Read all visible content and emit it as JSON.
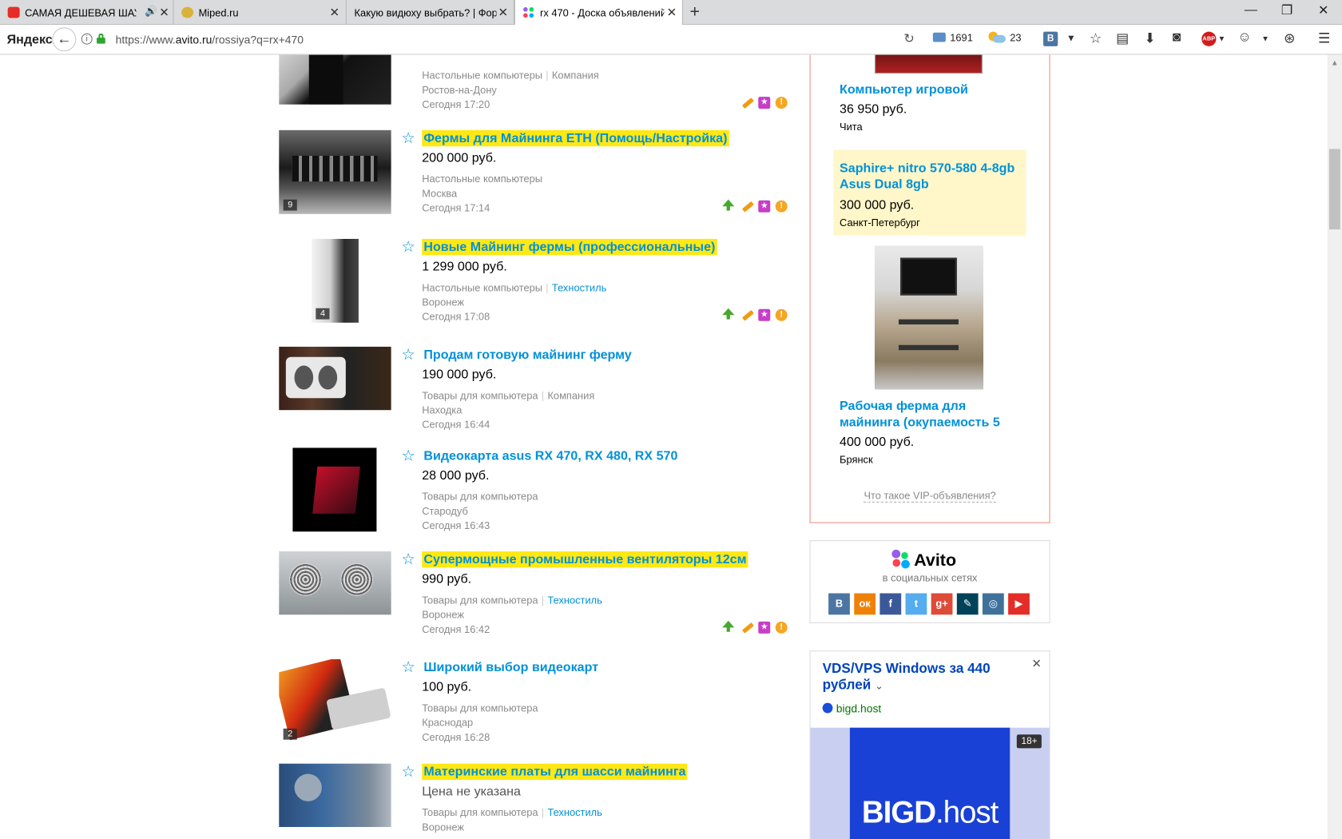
{
  "browser": {
    "tabs": [
      {
        "title": "САМАЯ ДЕШЕВАЯ ШАУ"
      },
      {
        "title": "Miped.ru"
      },
      {
        "title": "Какую видюху выбрать? | Фору"
      },
      {
        "title": "rx 470 - Доска объявлений"
      }
    ],
    "yandex_logo": "Яндекс",
    "url_prefix": "https://www.",
    "url_host": "avito.ru",
    "url_path": "/rossiya?q=rx+470",
    "mail_count": "1691",
    "weather_temp": "23",
    "vk_label": "В",
    "abp_label": "ABP"
  },
  "colors": {
    "link_blue": "#0091d9",
    "highlight": "#ffe813",
    "vip_border": "#f08f86",
    "vip_highlight": "#fff7c9"
  },
  "listings": [
    {
      "title": "",
      "price": "",
      "category": "Настольные компьютеры",
      "seller": "Компания",
      "seller_link": false,
      "city": "Ростов-на-Дону",
      "date": "Сегодня 17:20",
      "highlighted": false,
      "photos": ""
    },
    {
      "title": "Фермы для Майнинга ETH (Помощь/Настройка)",
      "price": "200 000 руб.",
      "category": "Настольные компьютеры",
      "seller": "",
      "seller_link": false,
      "city": "Москва",
      "date": "Сегодня 17:14",
      "highlighted": true,
      "photos": "9"
    },
    {
      "title": "Новые Майнинг фермы (профессиональные)",
      "price": "1 299 000 руб.",
      "category": "Настольные компьютеры",
      "seller": "Техностиль",
      "seller_link": true,
      "city": "Воронеж",
      "date": "Сегодня 17:08",
      "highlighted": true,
      "photos": "4"
    },
    {
      "title": "Продам готовую майнинг ферму",
      "price": "190 000 руб.",
      "category": "Товары для компьютера",
      "seller": "Компания",
      "seller_link": false,
      "city": "Находка",
      "date": "Сегодня 16:44",
      "highlighted": false,
      "photos": ""
    },
    {
      "title": "Видеокарта asus RX 470, RX 480, RX 570",
      "price": "28 000 руб.",
      "category": "Товары для компьютера",
      "seller": "",
      "seller_link": false,
      "city": "Стародуб",
      "date": "Сегодня 16:43",
      "highlighted": false,
      "photos": ""
    },
    {
      "title": "Супермощные промышленные вентиляторы 12см",
      "price": "990 руб.",
      "category": "Товары для компьютера",
      "seller": "Техностиль",
      "seller_link": true,
      "city": "Воронеж",
      "date": "Сегодня 16:42",
      "highlighted": true,
      "photos": ""
    },
    {
      "title": "Широкий выбор видеокарт",
      "price": "100 руб.",
      "category": "Товары для компьютера",
      "seller": "",
      "seller_link": false,
      "city": "Краснодар",
      "date": "Сегодня 16:28",
      "highlighted": false,
      "photos": "2"
    },
    {
      "title": "Материнские платы для шасси майнинга",
      "price": "Цена не указана",
      "category": "Товары для компьютера",
      "seller": "Техностиль",
      "seller_link": true,
      "city": "Воронеж",
      "date": "",
      "highlighted": true,
      "photos": ""
    }
  ],
  "vip": {
    "items": [
      {
        "title": "Компьютер игровой",
        "price": "36 950 руб.",
        "city": "Чита"
      },
      {
        "title": "Saphire+ nitro 570-580 4-8gb Asus Dual 8gb",
        "price": "300 000 руб.",
        "city": "Санкт-Петербург"
      },
      {
        "title": "Рабочая ферма для майнинга (окупаемость 5",
        "price": "400 000 руб.",
        "city": "Брянск"
      }
    ],
    "what_link": "Что такое VIP-объявления?"
  },
  "social": {
    "brand": "Avito",
    "subtitle": "в социальных сетях",
    "networks": [
      {
        "icon": "vk-icon",
        "glyph": "В",
        "color": "#4c75a3"
      },
      {
        "icon": "odnoklassniki-icon",
        "glyph": "ок",
        "color": "#ee8208"
      },
      {
        "icon": "facebook-icon",
        "glyph": "f",
        "color": "#3b5998"
      },
      {
        "icon": "twitter-icon",
        "glyph": "t",
        "color": "#55acee"
      },
      {
        "icon": "google-plus-icon",
        "glyph": "g+",
        "color": "#dd4b39"
      },
      {
        "icon": "livejournal-icon",
        "glyph": "✎",
        "color": "#004359"
      },
      {
        "icon": "instagram-icon",
        "glyph": "◎",
        "color": "#3f729b"
      },
      {
        "icon": "youtube-icon",
        "glyph": "▶",
        "color": "#e52d27"
      }
    ]
  },
  "ad": {
    "title": "VDS/VPS Windows за 440 рублей",
    "domain": "bigd.host",
    "brand_bold": "BIGD",
    "brand_rest": ".host",
    "age": "18+"
  }
}
